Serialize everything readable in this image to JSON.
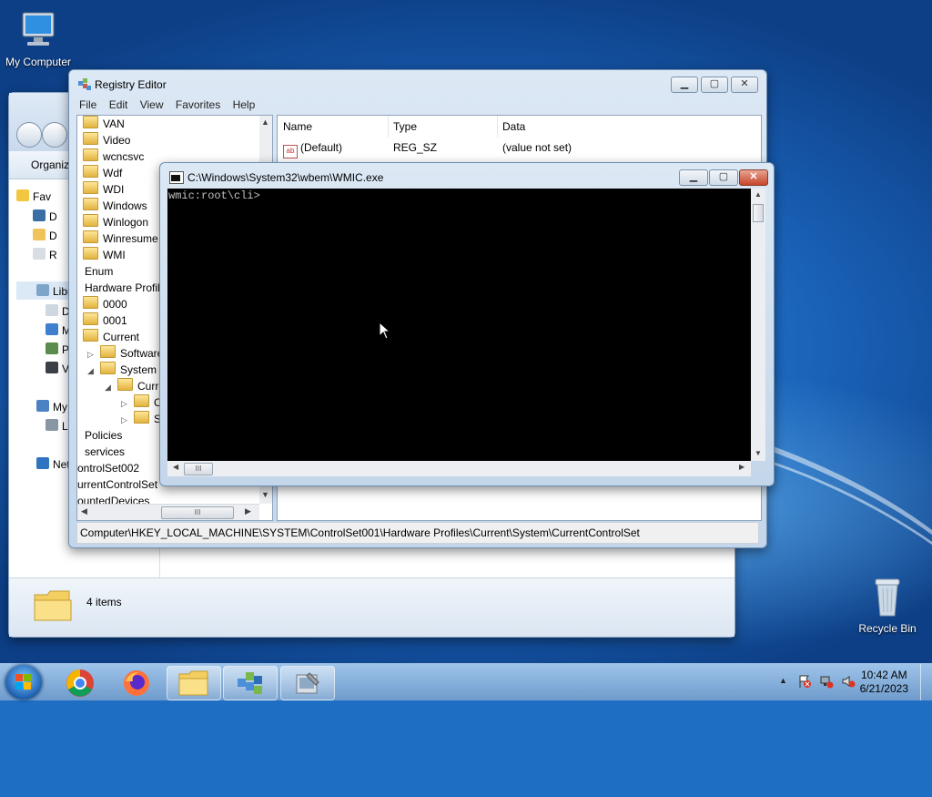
{
  "desktop": {
    "icons": [
      {
        "label": "My Computer",
        "icon": "computer-icon"
      },
      {
        "label": "Recycle Bin",
        "icon": "recycle-bin-icon"
      }
    ]
  },
  "explorer": {
    "organize_label": "Organiz",
    "nav": [
      "Fav",
      "D",
      "D",
      "R",
      "Libr",
      "D",
      "M",
      "P",
      "V",
      "My",
      "Lo",
      "Net"
    ],
    "status": "4 items"
  },
  "regedit": {
    "title": "Registry Editor",
    "menu": [
      "File",
      "Edit",
      "View",
      "Favorites",
      "Help"
    ],
    "tree": [
      {
        "label": "VAN",
        "folder": true
      },
      {
        "label": "Video",
        "folder": true
      },
      {
        "label": "wcncsvc",
        "folder": true
      },
      {
        "label": "Wdf",
        "folder": true
      },
      {
        "label": "WDI",
        "folder": true
      },
      {
        "label": "Windows",
        "folder": true
      },
      {
        "label": "Winlogon",
        "folder": true
      },
      {
        "label": "Winresume",
        "folder": true
      },
      {
        "label": "WMI",
        "folder": true
      },
      {
        "label": "Enum",
        "folder": false
      },
      {
        "label": "Hardware Profil",
        "folder": false
      },
      {
        "label": "0000",
        "folder": true
      },
      {
        "label": "0001",
        "folder": true
      },
      {
        "label": "Current",
        "folder": true
      },
      {
        "label": "Software",
        "folder": true
      },
      {
        "label": "System",
        "folder": true
      },
      {
        "label": "Curre",
        "folder": true
      },
      {
        "label": "C",
        "folder": true
      },
      {
        "label": "S",
        "folder": true
      },
      {
        "label": "Policies",
        "folder": false
      },
      {
        "label": "services",
        "folder": false
      },
      {
        "label": "ontrolSet002",
        "folder": false
      },
      {
        "label": "urrentControlSet",
        "folder": false
      },
      {
        "label": "ountedDevices",
        "folder": false
      }
    ],
    "columns": [
      "Name",
      "Type",
      "Data"
    ],
    "values": [
      {
        "name": "(Default)",
        "type": "REG_SZ",
        "data": "(value not set)"
      }
    ],
    "status_path": "Computer\\HKEY_LOCAL_MACHINE\\SYSTEM\\ControlSet001\\Hardware Profiles\\Current\\System\\CurrentControlSet"
  },
  "wmic": {
    "title": "C:\\Windows\\System32\\wbem\\WMIC.exe",
    "prompt": "wmic:root\\cli>"
  },
  "taskbar": {
    "apps": [
      "start-orb",
      "chrome-icon",
      "firefox-icon",
      "explorer-icon",
      "registry-icon",
      "wmic-tool-icon"
    ],
    "time": "10:42 AM",
    "date": "6/21/2023"
  }
}
